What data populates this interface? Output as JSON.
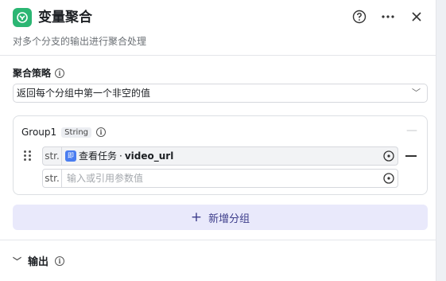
{
  "header": {
    "title": "变量聚合",
    "description": "对多个分支的输出进行聚合处理",
    "icons": [
      "node-icon",
      "help-icon",
      "more-icon",
      "close-icon"
    ]
  },
  "strategy": {
    "label": "聚合策略",
    "selected": "返回每个分组中第一个非空的值"
  },
  "group": {
    "name": "Group1",
    "type": "String",
    "rows": [
      {
        "type_tag": "str.",
        "node_badge": "即",
        "node_name": "查看任务",
        "separator": "·",
        "variable": "video_url"
      },
      {
        "type_tag": "str.",
        "placeholder": "输入或引用参数值"
      }
    ]
  },
  "add_group_label": "新增分组",
  "output_label": "输出",
  "colors": {
    "accent": "#2bb673",
    "add_group_bg": "#e9e9fb",
    "ref_icon": "#4a7df0"
  }
}
